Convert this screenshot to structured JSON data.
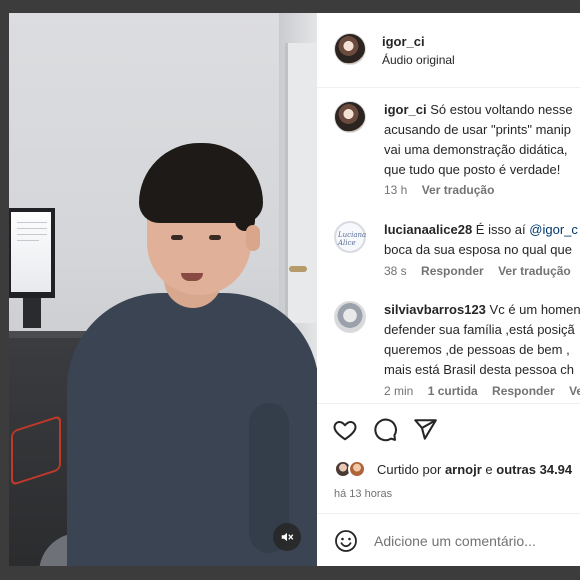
{
  "post": {
    "author": "igor_ci",
    "audio": "Áudio original"
  },
  "comments": [
    {
      "username": "igor_ci",
      "lines": [
        "Só estou voltando nesse",
        "acusando de usar \"prints\" manip",
        "vai uma demonstração didática,",
        "que tudo que posto é verdade!"
      ],
      "time": "13 h",
      "translate": "Ver tradução"
    },
    {
      "username": "lucianaalice28",
      "lines": [
        "É isso aí",
        "boca da sua esposa no qual que"
      ],
      "mention": "@igor_c",
      "avatar_text": "Luciana Alice",
      "time": "38 s",
      "reply": "Responder",
      "translate": "Ver tradução"
    },
    {
      "username": "silviavbarros123",
      "lines": [
        "Vc é um homen",
        "defender sua família ,está posiçã",
        "queremos ,de pessoas de bem ,",
        "mais está Brasil desta pessoa ch"
      ],
      "time": "2 min",
      "likes": "1 curtida",
      "reply": "Responder",
      "translate": "Ver tr"
    }
  ],
  "actions": {
    "icons": [
      "heart-icon",
      "comment-icon",
      "share-icon"
    ],
    "liked_by_prefix": "Curtido por",
    "liked_by_user": "arnojr",
    "liked_by_sep": "e",
    "liked_by_others": "outras 34.94",
    "time_ago": "há 13 horas"
  },
  "composer": {
    "placeholder": "Adicione um comentário..."
  },
  "colors": {
    "text": "#262626",
    "secondary": "#737373",
    "mention": "#00376b",
    "video_button_bg": "#262626"
  }
}
